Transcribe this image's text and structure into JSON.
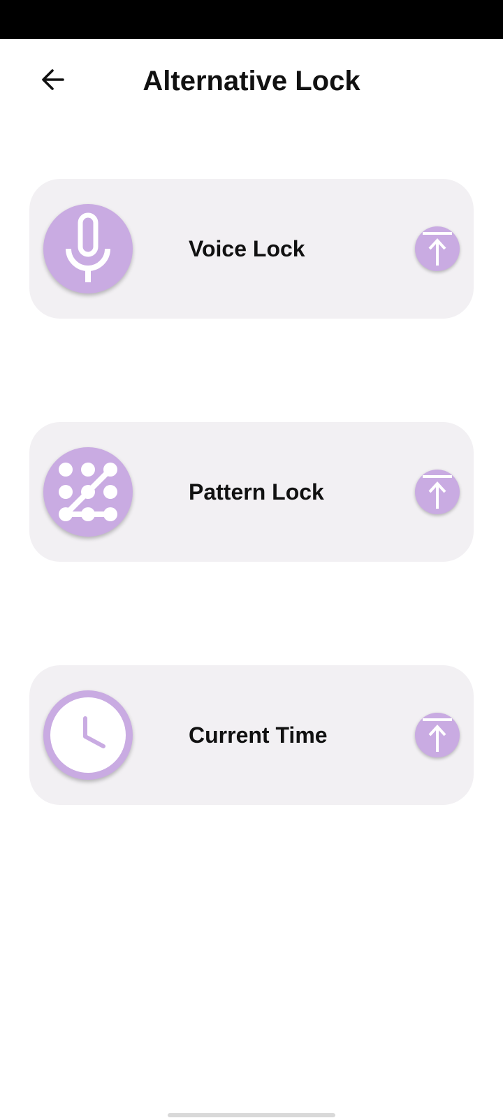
{
  "header": {
    "title": "Alternative Lock",
    "back_icon": "arrow-left-icon"
  },
  "colors": {
    "accent": "#c9abe2",
    "card_background": "#f2f0f3",
    "text": "#111111",
    "status_bar": "#000000"
  },
  "options": [
    {
      "label": "Voice Lock",
      "icon": "microphone-icon",
      "action_icon": "upload-icon"
    },
    {
      "label": "Pattern Lock",
      "icon": "pattern-grid-icon",
      "action_icon": "upload-icon"
    },
    {
      "label": "Current Time",
      "icon": "clock-icon",
      "action_icon": "upload-icon"
    }
  ]
}
